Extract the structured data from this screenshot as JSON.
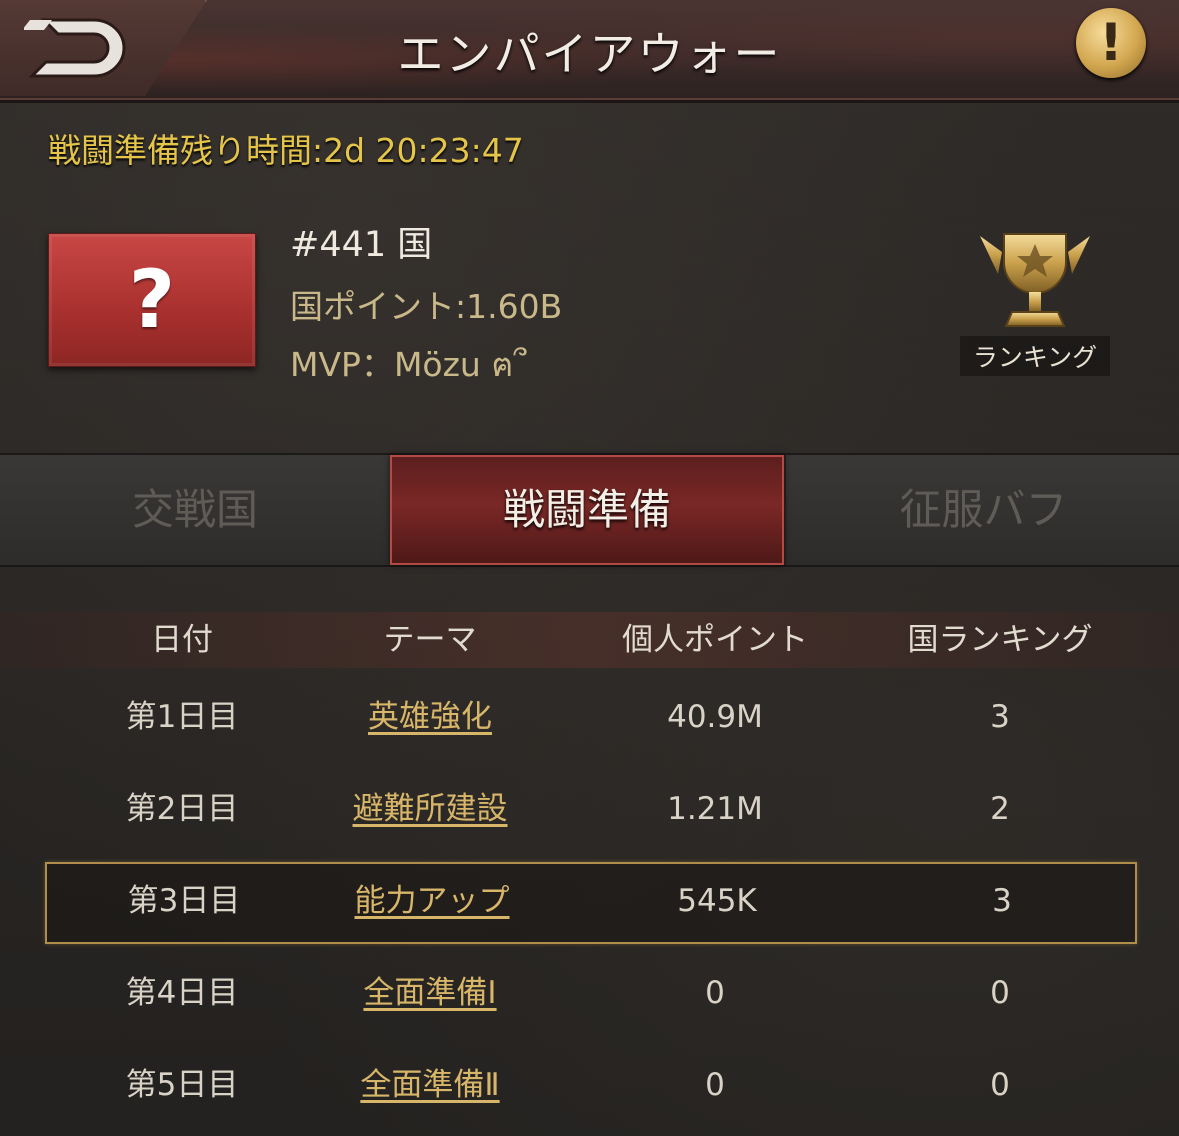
{
  "header": {
    "title": "エンパイアウォー",
    "info_label": "!"
  },
  "countdown": "戦闘準備残り時間:2d 20:23:47",
  "country": {
    "flag_label": "?",
    "name": "#441 国",
    "points": "国ポイント:1.60B",
    "mvp": "MVP：Mözu ฅ՞"
  },
  "ranking": {
    "label": "ランキング"
  },
  "tabs": [
    {
      "label": "交戦国",
      "active": false
    },
    {
      "label": "戦闘準備",
      "active": true
    },
    {
      "label": "征服バフ",
      "active": false
    }
  ],
  "table": {
    "headers": [
      "日付",
      "テーマ",
      "個人ポイント",
      "国ランキング"
    ],
    "rows": [
      {
        "day": "第1日目",
        "theme": "英雄強化",
        "points": "40.9M",
        "rank": "3"
      },
      {
        "day": "第2日目",
        "theme": "避難所建設",
        "points": "1.21M",
        "rank": "2"
      },
      {
        "day": "第3日目",
        "theme": "能力アップ",
        "points": "545K",
        "rank": "3"
      },
      {
        "day": "第4日目",
        "theme": "全面準備Ⅰ",
        "points": "0",
        "rank": "0"
      },
      {
        "day": "第5日目",
        "theme": "全面準備Ⅱ",
        "points": "0",
        "rank": "0"
      }
    ],
    "highlighted_row": 2
  },
  "colors": {
    "accent_gold": "#d7b66a",
    "countdown_yellow": "#e4c54a",
    "active_tab_red": "#7a2826"
  }
}
